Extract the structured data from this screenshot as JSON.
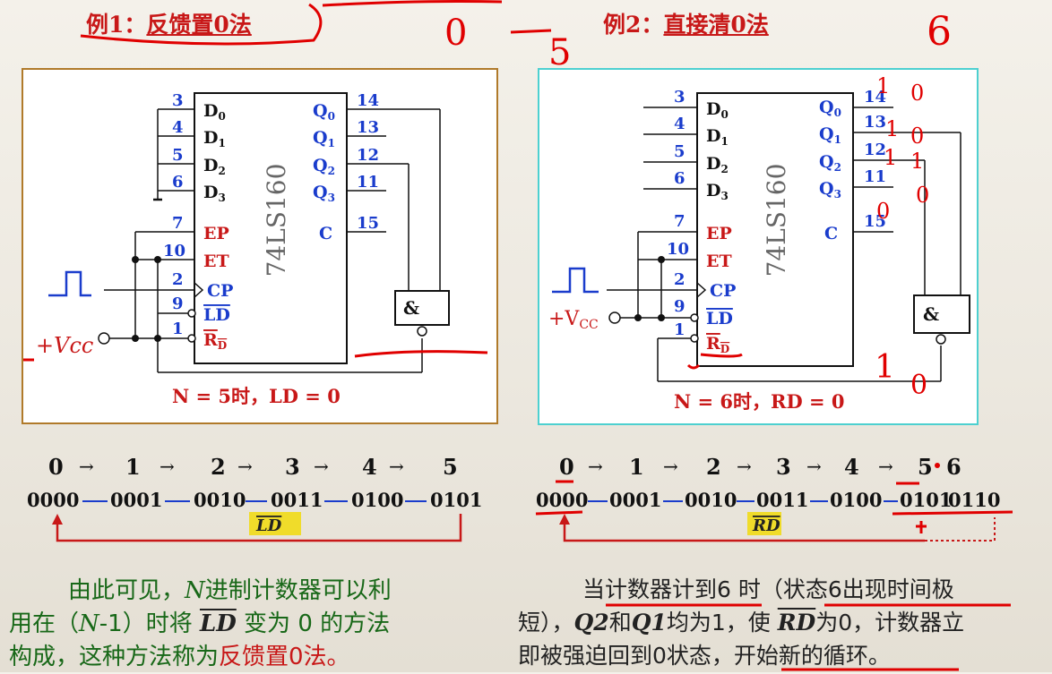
{
  "example1": {
    "prefix": "例1：",
    "title": "反馈置0法"
  },
  "example2": {
    "prefix": "例2：",
    "title": "直接清0法"
  },
  "chip": {
    "name": "74LS160",
    "inputs": [
      {
        "pin": "3",
        "name": "D0"
      },
      {
        "pin": "4",
        "name": "D1"
      },
      {
        "pin": "5",
        "name": "D2"
      },
      {
        "pin": "6",
        "name": "D3"
      },
      {
        "pin": "7",
        "name": "EP"
      },
      {
        "pin": "10",
        "name": "ET"
      },
      {
        "pin": "2",
        "name": "CP"
      },
      {
        "pin": "9",
        "name": "LD"
      },
      {
        "pin": "1",
        "name": "RD"
      }
    ],
    "outputs": [
      {
        "pin": "14",
        "name": "Q0"
      },
      {
        "pin": "13",
        "name": "Q1"
      },
      {
        "pin": "12",
        "name": "Q2"
      },
      {
        "pin": "11",
        "name": "Q3"
      },
      {
        "pin": "15",
        "name": "C"
      }
    ]
  },
  "gate_label": "&",
  "vcc_label": "+V",
  "vcc_sub": "CC",
  "vcc_label_handwritten": "+Vcc",
  "circuit1_condition": "N = 5时，LD = 0",
  "circuit2_condition": "N = 6时，RD = 0",
  "handwritten": {
    "top_digits": [
      "0",
      "5",
      "6"
    ],
    "right_ones": [
      "1",
      "1",
      "1",
      "1"
    ],
    "right_zeros": [
      "0",
      "0",
      "0",
      "0"
    ],
    "bottom": [
      "1",
      "0"
    ]
  },
  "sequence1": {
    "decimal": [
      "0",
      "1",
      "2",
      "3",
      "4",
      "5"
    ],
    "binary": [
      "0000",
      "0001",
      "0010",
      "0011",
      "0100",
      "0101"
    ],
    "tag": "LD"
  },
  "sequence2": {
    "decimal": [
      "0",
      "1",
      "2",
      "3",
      "4",
      "5",
      "6"
    ],
    "binary": [
      "0000",
      "0001",
      "0010",
      "0011",
      "0100",
      "0101",
      "0110"
    ],
    "tag": "RD"
  },
  "text_left": {
    "l1a": "由此可见，",
    "l1b": "N",
    "l1c": "进制计数器可以利",
    "l2a": "用在（",
    "l2b": "N",
    "l2c": "-1）时将 ",
    "l2d": "LD",
    "l2e": " 变为 0 的方法",
    "l3a": "构成，这种方法称为",
    "l3b": "反馈置0法。"
  },
  "text_right": {
    "l1": "当计数器计到6 时（状态6出现时间极",
    "l2a": "短），",
    "l2b": "Q2",
    "l2c": "和",
    "l2d": "Q1",
    "l2e": "均为1，使 ",
    "l2f": "RD",
    "l2g": "为0，计数器立",
    "l3": "即被强迫回到0状态，开始新的循环。"
  }
}
